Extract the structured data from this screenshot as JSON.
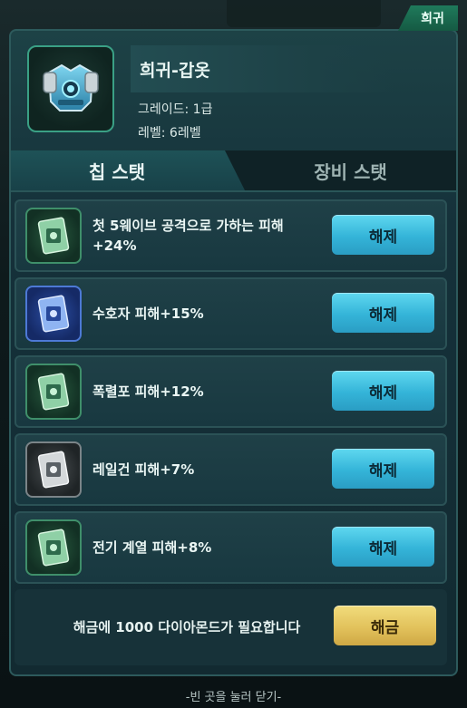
{
  "rarity_tag": "희귀",
  "item": {
    "title": "희귀-갑옷",
    "grade": "그레이드: 1급",
    "level": "레벨: 6레벨",
    "icon": "armor-vest-icon"
  },
  "tabs": [
    {
      "label": "칩 스탯",
      "active": true
    },
    {
      "label": "장비 스탯",
      "active": false
    }
  ],
  "stats": [
    {
      "label": "첫 5웨이브 공격으로 가하는 피해+24%",
      "chip_color": "green",
      "button": "해제",
      "icon": "green-chip-icon"
    },
    {
      "label": "수호자 피해+15%",
      "chip_color": "blue",
      "button": "해제",
      "icon": "blue-chip-icon"
    },
    {
      "label": "폭렬포 피해+12%",
      "chip_color": "green",
      "button": "해제",
      "icon": "green-chip-icon"
    },
    {
      "label": "레일건 피해+7%",
      "chip_color": "gray",
      "button": "해제",
      "icon": "gray-chip-icon"
    },
    {
      "label": "전기 계열 피해+8%",
      "chip_color": "green",
      "button": "해제",
      "icon": "green-chip-icon"
    }
  ],
  "unlock": {
    "text": "해금에 1000 다이아몬드가 필요합니다",
    "button": "해금"
  },
  "close_hint": "-빈 곳을 눌러 닫기-",
  "colors": {
    "release_button": "#3cbfe0",
    "unlock_button": "#e2c25c",
    "rarity": "#1f7a5b"
  }
}
